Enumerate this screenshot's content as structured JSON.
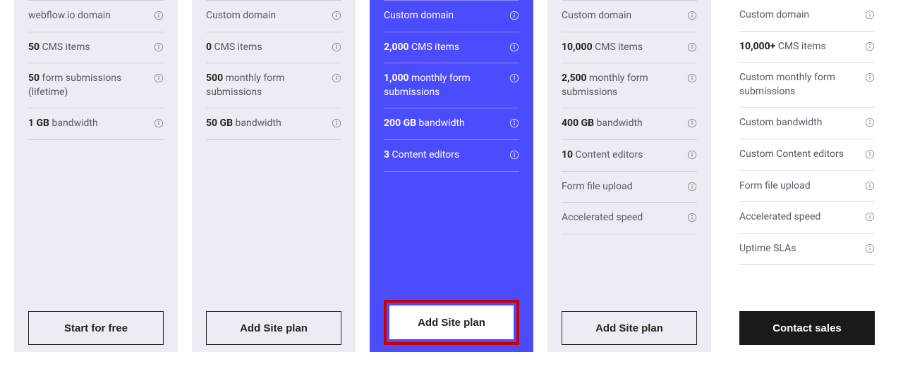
{
  "plans": [
    {
      "features": [
        {
          "bold": "",
          "text": "webflow.io domain",
          "info": true
        },
        {
          "bold": "50",
          "text": " CMS items",
          "info": true
        },
        {
          "bold": "50",
          "text": " form submissions (lifetime)",
          "info": true
        },
        {
          "bold": "1 GB",
          "text": " bandwidth",
          "info": true
        }
      ],
      "cta": "Start for free"
    },
    {
      "features": [
        {
          "bold": "",
          "text": "Custom domain",
          "info": true
        },
        {
          "bold": "0",
          "text": " CMS items",
          "info": true
        },
        {
          "bold": "500",
          "text": " monthly form submissions",
          "info": true
        },
        {
          "bold": "50 GB",
          "text": " bandwidth",
          "info": true
        }
      ],
      "cta": "Add Site plan"
    },
    {
      "features": [
        {
          "bold": "",
          "text": "Custom domain",
          "info": true
        },
        {
          "bold": "2,000",
          "text": " CMS items",
          "info": true
        },
        {
          "bold": "1,000",
          "text": " monthly form submissions",
          "info": true
        },
        {
          "bold": "200 GB",
          "text": " bandwidth",
          "info": true
        },
        {
          "bold": "3",
          "text": " Content editors",
          "info": true
        }
      ],
      "cta": "Add Site plan"
    },
    {
      "features": [
        {
          "bold": "",
          "text": "Custom domain",
          "info": true
        },
        {
          "bold": "10,000",
          "text": " CMS items",
          "info": true
        },
        {
          "bold": "2,500",
          "text": " monthly form submissions",
          "info": true
        },
        {
          "bold": "400 GB",
          "text": " bandwidth",
          "info": true
        },
        {
          "bold": "10",
          "text": " Content editors",
          "info": true
        },
        {
          "bold": "",
          "text": "Form file upload",
          "info": true
        },
        {
          "bold": "",
          "text": "Accelerated speed",
          "info": true
        }
      ],
      "cta": "Add Site plan"
    },
    {
      "features": [
        {
          "bold": "",
          "text": "Custom domain",
          "info": true
        },
        {
          "bold": "10,000+",
          "text": " CMS items",
          "info": true
        },
        {
          "bold": "",
          "text": "Custom monthly form submissions",
          "info": true
        },
        {
          "bold": "",
          "text": "Custom bandwidth",
          "info": true
        },
        {
          "bold": "",
          "text": "Custom Content editors",
          "info": true
        },
        {
          "bold": "",
          "text": "Form file upload",
          "info": true
        },
        {
          "bold": "",
          "text": "Accelerated speed",
          "info": true
        },
        {
          "bold": "",
          "text": "Uptime SLAs",
          "info": true
        }
      ],
      "cta": "Contact sales"
    }
  ]
}
